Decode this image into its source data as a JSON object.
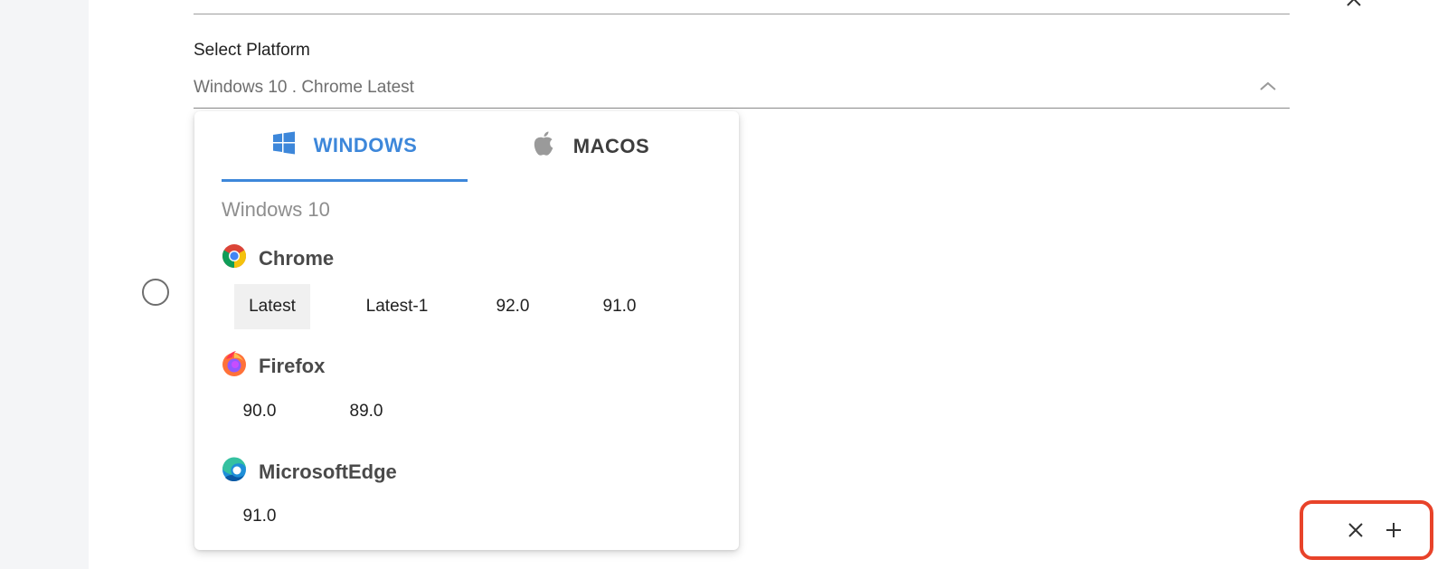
{
  "field": {
    "label": "Select Platform",
    "value": "Windows 10 . Chrome Latest"
  },
  "tabs": [
    {
      "label": "WINDOWS",
      "icon": "windows-icon",
      "active": true
    },
    {
      "label": "MACOS",
      "icon": "apple-icon",
      "active": false
    }
  ],
  "os_heading": "Windows 10",
  "browsers": [
    {
      "name": "Chrome",
      "icon": "chrome-icon",
      "versions": [
        "Latest",
        "Latest-1",
        "92.0",
        "91.0"
      ],
      "selected": "Latest"
    },
    {
      "name": "Firefox",
      "icon": "firefox-icon",
      "versions": [
        "90.0",
        "89.0"
      ]
    },
    {
      "name": "MicrosoftEdge",
      "icon": "edge-icon",
      "versions": [
        "91.0"
      ]
    }
  ],
  "colors": {
    "accent": "#3d87da",
    "highlight_box": "#e8432a",
    "selected_bg": "#f0f0f0"
  }
}
